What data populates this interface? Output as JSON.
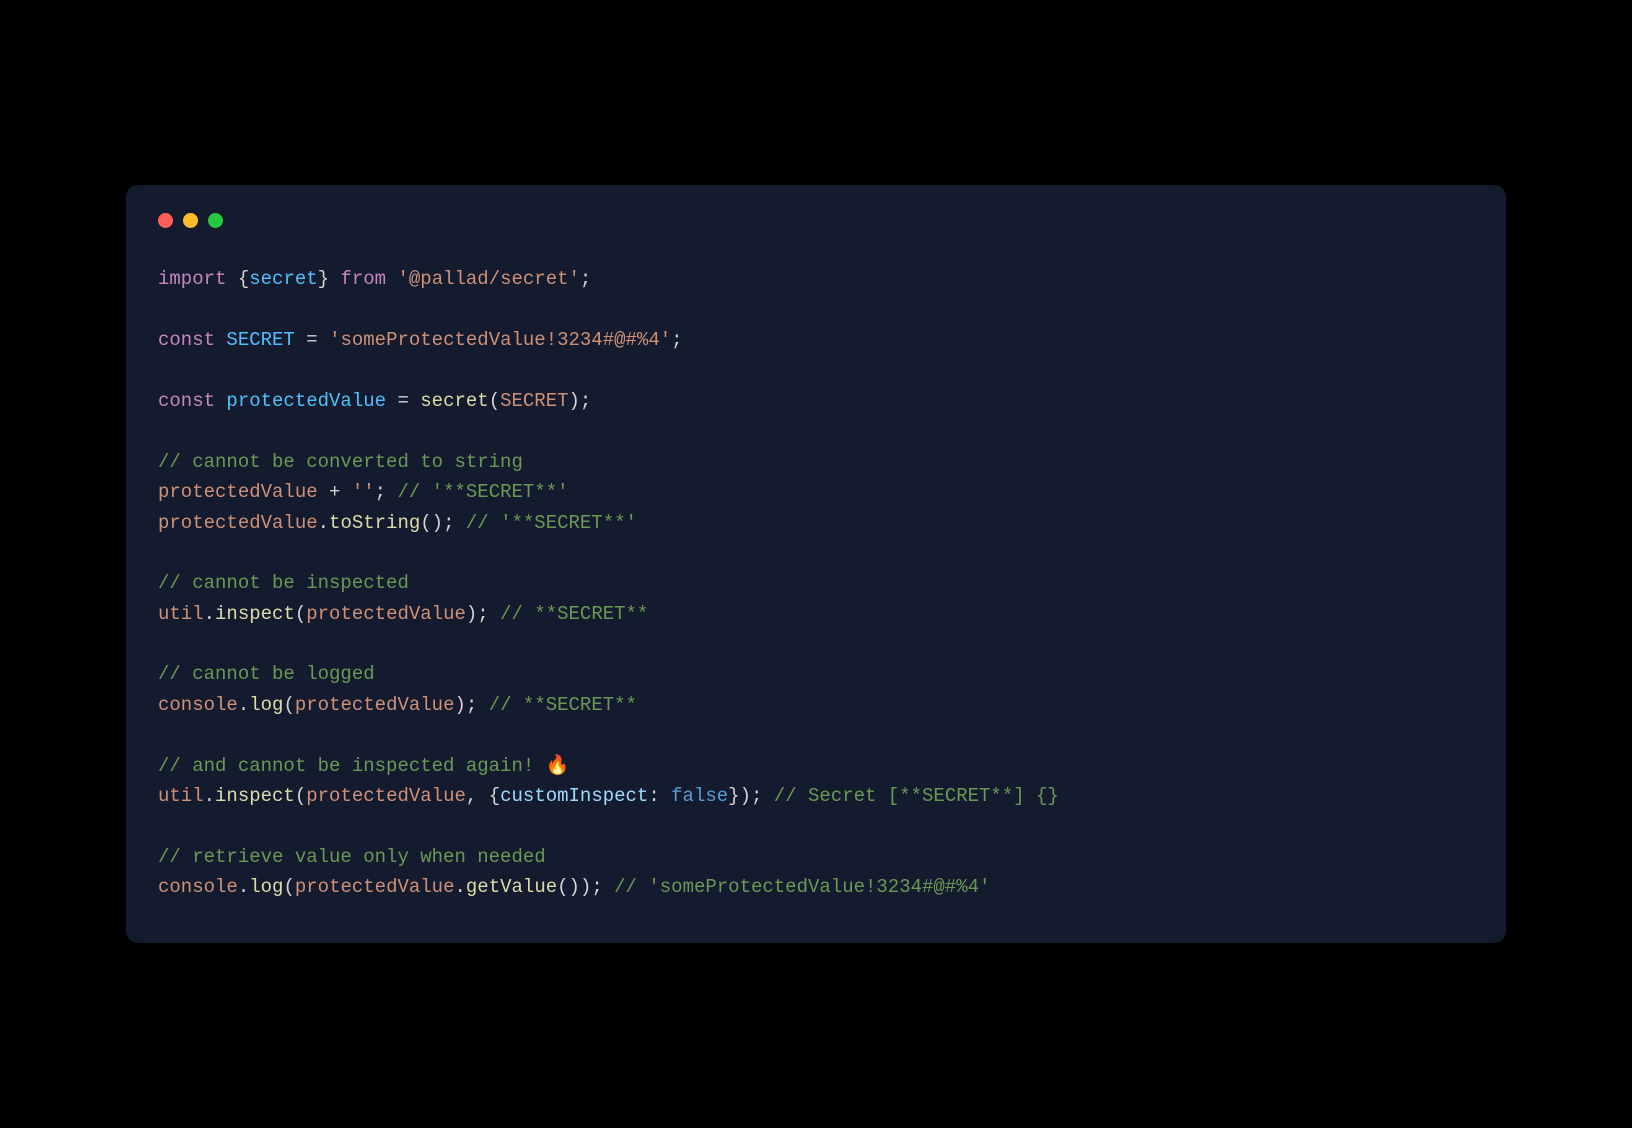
{
  "code": {
    "l1": {
      "import": "import",
      "lbrace": " {",
      "secret": "secret",
      "rbrace": "}",
      "from": " from ",
      "pkg": "'@pallad/secret'",
      "semi": ";"
    },
    "l3": {
      "const": "const",
      "name": " SECRET",
      "eq": " = ",
      "val": "'someProtectedValue!3234#@#%4'",
      "semi": ";"
    },
    "l5": {
      "const": "const",
      "name": " protectedValue",
      "eq": " = ",
      "fn": "secret",
      "lp": "(",
      "arg": "SECRET",
      "rp": ")",
      "semi": ";"
    },
    "l7": {
      "comment": "// cannot be converted to string"
    },
    "l8": {
      "obj": "protectedValue",
      "plus": " + ",
      "str": "''",
      "semi": ";",
      "comment": " // '**SECRET**'"
    },
    "l9": {
      "obj": "protectedValue",
      "dot": ".",
      "fn": "toString",
      "paren": "()",
      "semi": ";",
      "comment": " // '**SECRET**'"
    },
    "l11": {
      "comment": "// cannot be inspected"
    },
    "l12": {
      "obj": "util",
      "dot": ".",
      "fn": "inspect",
      "lp": "(",
      "arg": "protectedValue",
      "rp": ")",
      "semi": ";",
      "comment": " // **SECRET**"
    },
    "l14": {
      "comment": "// cannot be logged"
    },
    "l15": {
      "obj": "console",
      "dot": ".",
      "fn": "log",
      "lp": "(",
      "arg": "protectedValue",
      "rp": ")",
      "semi": ";",
      "comment": " // **SECRET**"
    },
    "l17": {
      "comment": "// and cannot be inspected again! 🔥"
    },
    "l18": {
      "obj": "util",
      "dot": ".",
      "fn": "inspect",
      "lp": "(",
      "arg": "protectedValue",
      "comma": ", ",
      "lbrace": "{",
      "key": "customInspect",
      "colon": ": ",
      "val": "false",
      "rbrace": "}",
      "rp": ")",
      "semi": ";",
      "comment": " // Secret [**SECRET**] {}"
    },
    "l20": {
      "comment": "// retrieve value only when needed"
    },
    "l21": {
      "obj": "console",
      "dot": ".",
      "fn": "log",
      "lp": "(",
      "arg": "protectedValue",
      "dot2": ".",
      "fn2": "getValue",
      "paren": "()",
      "rp": ")",
      "semi": ";",
      "comment": " // 'someProtectedValue!3234#@#%4'"
    }
  }
}
